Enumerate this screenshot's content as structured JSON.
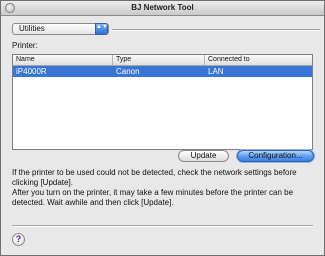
{
  "window": {
    "title": "BJ Network Tool"
  },
  "menu": {
    "selected": "Utilities",
    "arrows_glyph": "▲▼"
  },
  "printer_label": "Printer:",
  "table": {
    "columns": [
      "Name",
      "Type",
      "Connected to"
    ],
    "rows": [
      {
        "name": "iP4000R",
        "type": "Canon",
        "connected": "LAN",
        "selected": true
      }
    ]
  },
  "buttons": {
    "update": "Update",
    "configuration": "Configuration..."
  },
  "info": {
    "line1": "If the printer to be used could not be detected, check the network settings before clicking [Update].",
    "line2": "After you turn on the printer, it may take a few minutes before the printer can be detected. Wait awhile and then click [Update]."
  },
  "help": {
    "glyph": "?"
  },
  "colors": {
    "selection": "#3875d7",
    "default_button": "#3d82e6"
  }
}
